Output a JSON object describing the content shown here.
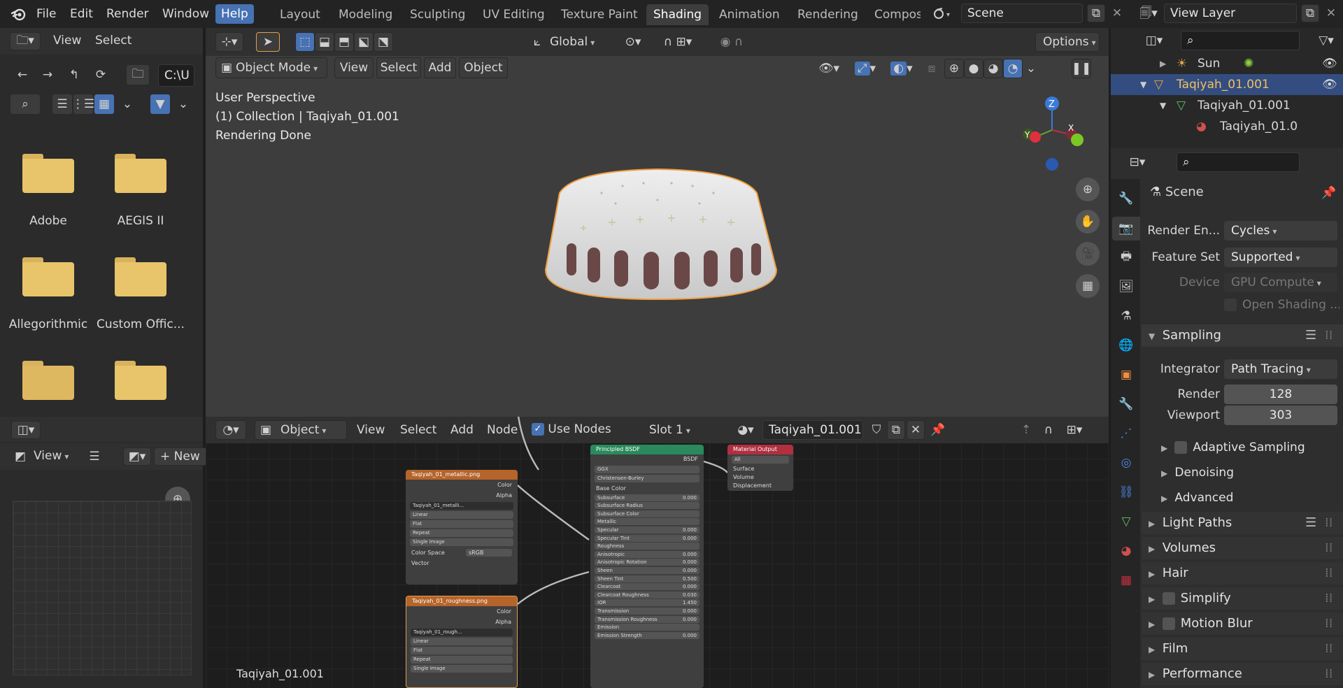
{
  "topbar": {
    "menus": [
      "File",
      "Edit",
      "Render",
      "Window",
      "Help"
    ],
    "workspace_tabs": [
      "Layout",
      "Modeling",
      "Sculpting",
      "UV Editing",
      "Texture Paint",
      "Shading",
      "Animation",
      "Rendering",
      "Compos"
    ],
    "active_tab": "Shading",
    "scene_name": "Scene",
    "view_layer": "View Layer"
  },
  "filebrowser": {
    "view_label": "View",
    "select_label": "Select",
    "path": "C:\\U",
    "folders": [
      "Adobe",
      "AEGIS II",
      "Allegorithmic",
      "Custom Offic...",
      "",
      ""
    ]
  },
  "imageeditor": {
    "view_label": "View",
    "new_label": "New",
    "footer_label": "Taqiyah_01.001"
  },
  "viewport_header": {
    "transform": "Global",
    "options": "Options",
    "mode": "Object Mode",
    "menus": [
      "View",
      "Select",
      "Add",
      "Object"
    ]
  },
  "viewport": {
    "line1": "User Perspective",
    "line2": "(1) Collection | Taqiyah_01.001",
    "line3": "Rendering Done",
    "gizmo": {
      "z": "Z",
      "y": "Y",
      "x": "X"
    }
  },
  "node_header": {
    "object": "Object",
    "menus": [
      "View",
      "Select",
      "Add",
      "Node"
    ],
    "use_nodes": "Use Nodes",
    "slot": "Slot 1",
    "material": "Taqiyah_01.001"
  },
  "nodes": {
    "metallic": {
      "title": "Taqiyah_01_metallic.png",
      "out_color": "Color",
      "out_alpha": "Alpha",
      "image": "Taqiyah_01_metalli...",
      "fields": [
        "Linear",
        "Flat",
        "Repeat",
        "Single Image"
      ],
      "color_space_label": "Color Space",
      "color_space": "sRGB",
      "vector": "Vector"
    },
    "roughness": {
      "title": "Taqiyah_01_roughness.png",
      "out_color": "Color",
      "out_alpha": "Alpha",
      "image": "Taqiyah_01_rough...",
      "fields": [
        "Linear",
        "Flat",
        "Repeat",
        "Single Image"
      ]
    },
    "bsdf": {
      "title": "Principled BSDF",
      "out": "BSDF",
      "distribution": "GGX",
      "subsurface_method": "Christensen-Burley",
      "base_color": "Base Color",
      "rows": [
        {
          "label": "Subsurface",
          "value": "0.000"
        },
        {
          "label": "Subsurface Radius",
          "value": ""
        },
        {
          "label": "Subsurface Color",
          "value": ""
        },
        {
          "label": "Metallic",
          "value": ""
        },
        {
          "label": "Specular",
          "value": "0.000"
        },
        {
          "label": "Specular Tint",
          "value": "0.000"
        },
        {
          "label": "Roughness",
          "value": ""
        },
        {
          "label": "Anisotropic",
          "value": "0.000"
        },
        {
          "label": "Anisotropic Rotation",
          "value": "0.000"
        },
        {
          "label": "Sheen",
          "value": "0.000"
        },
        {
          "label": "Sheen Tint",
          "value": "0.500"
        },
        {
          "label": "Clearcoat",
          "value": "0.000"
        },
        {
          "label": "Clearcoat Roughness",
          "value": "0.030"
        },
        {
          "label": "IOR",
          "value": "1.450"
        },
        {
          "label": "Transmission",
          "value": "0.000"
        },
        {
          "label": "Transmission Roughness",
          "value": "0.000"
        },
        {
          "label": "Emission",
          "value": ""
        },
        {
          "label": "Emission Strength",
          "value": "0.000"
        }
      ]
    },
    "output": {
      "title": "Material Output",
      "target": "All",
      "inputs": [
        "Surface",
        "Volume",
        "Displacement"
      ]
    }
  },
  "outliner": {
    "rows": [
      {
        "label": "Sun"
      },
      {
        "label": "Taqiyah_01.001"
      },
      {
        "label": "Taqiyah_01.001"
      },
      {
        "label": "Taqiyah_01.0"
      }
    ]
  },
  "properties": {
    "context": "Scene",
    "render_engine_label": "Render En...",
    "render_engine": "Cycles",
    "feature_set_label": "Feature Set",
    "feature_set": "Supported",
    "device_label": "Device",
    "device": "GPU Compute",
    "open_shading": "Open Shading ...",
    "sampling": "Sampling",
    "integrator_label": "Integrator",
    "integrator": "Path Tracing",
    "render_label": "Render",
    "render_samples": "128",
    "viewport_label": "Viewport",
    "viewport_samples": "303",
    "adaptive": "Adaptive Sampling",
    "denoising": "Denoising",
    "advanced": "Advanced",
    "sections": [
      "Light Paths",
      "Volumes",
      "Hair",
      "Simplify",
      "Motion Blur",
      "Film",
      "Performance"
    ]
  },
  "colors": {
    "accent": "#4772b3",
    "selection": "#f0a040",
    "folder": "#e8c46a"
  }
}
